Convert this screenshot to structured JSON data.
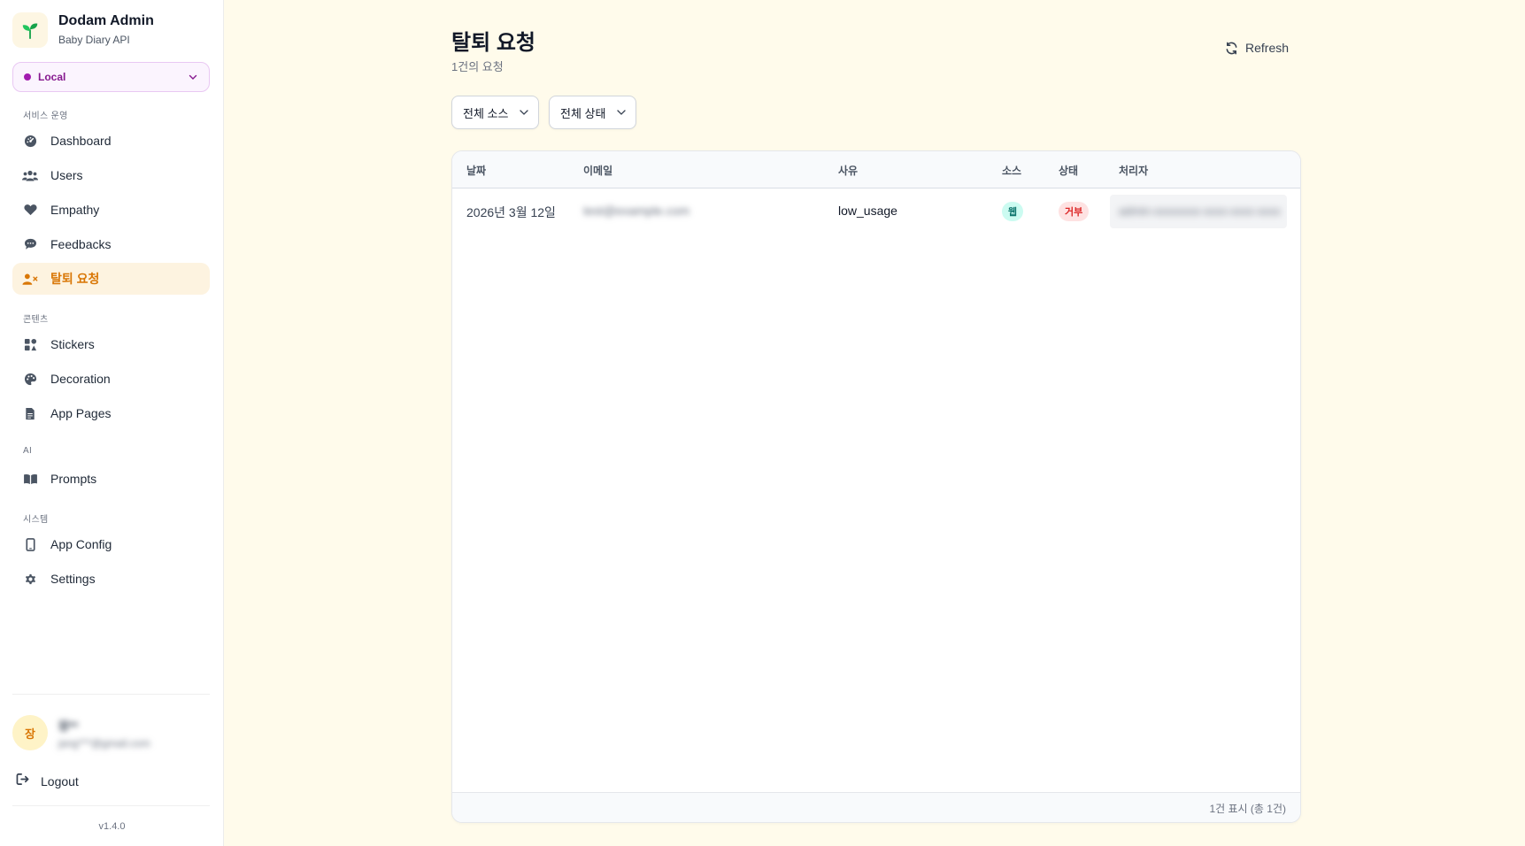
{
  "brand": {
    "title": "Dodam Admin",
    "subtitle": "Baby Diary API"
  },
  "environment": {
    "label": "Local",
    "dot_color": "#a21caf"
  },
  "sidebar": {
    "sections": {
      "service": "서비스 운영",
      "content": "콘텐츠",
      "ai": "AI",
      "system": "시스템"
    },
    "items": [
      {
        "label": "Dashboard",
        "icon": "dashboard-icon"
      },
      {
        "label": "Users",
        "icon": "users-icon"
      },
      {
        "label": "Empathy",
        "icon": "heart-icon"
      },
      {
        "label": "Feedbacks",
        "icon": "comment-icon"
      },
      {
        "label": "탈퇴 요청",
        "icon": "user-remove-icon",
        "active": true
      },
      {
        "label": "Stickers",
        "icon": "stickers-icon"
      },
      {
        "label": "Decoration",
        "icon": "palette-icon"
      },
      {
        "label": "App Pages",
        "icon": "document-icon"
      },
      {
        "label": "Prompts",
        "icon": "book-icon"
      },
      {
        "label": "App Config",
        "icon": "mobile-icon"
      },
      {
        "label": "Settings",
        "icon": "gear-icon"
      }
    ]
  },
  "user": {
    "avatar_initial": "장",
    "name": "장**",
    "email": "jang***@gmail.com"
  },
  "logout_label": "Logout",
  "version": "v1.4.0",
  "main": {
    "title": "탈퇴 요청",
    "subtitle": "1건의 요청",
    "refresh_label": "Refresh",
    "filters": {
      "source": "전체 소스",
      "status": "전체 상태"
    },
    "table": {
      "headers": {
        "date": "날짜",
        "email": "이메일",
        "reason": "사유",
        "source": "소스",
        "status": "상태",
        "handler": "처리자"
      },
      "rows": [
        {
          "date": "2026년 3월 12일",
          "email": "test@example.com",
          "reason": "low_usage",
          "source": "웹",
          "status": "거부",
          "handler": "admin-xxxxxxxx-xxxx-xxxx-xxxx"
        }
      ],
      "footer": "1건 표시 (총 1건)"
    }
  },
  "colors": {
    "accent": "#d97706",
    "background": "#fffbeb",
    "active_bg": "#fdf3e0"
  }
}
